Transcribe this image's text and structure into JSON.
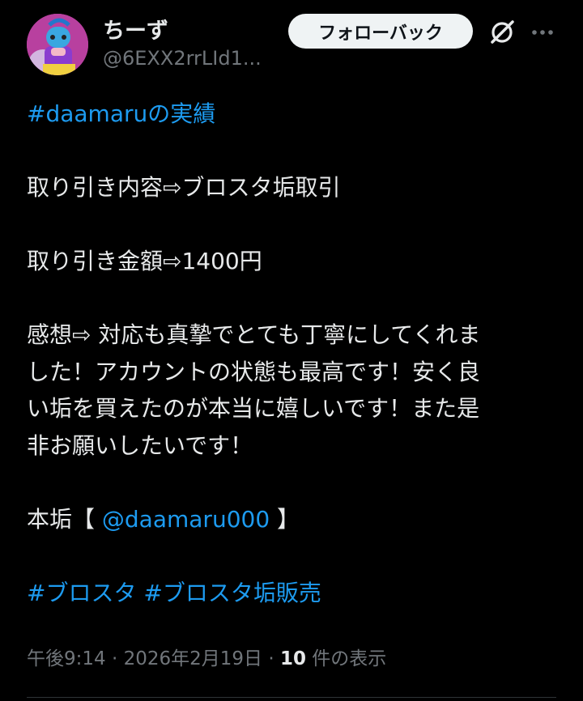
{
  "author": {
    "display_name": "ちーず",
    "handle": "@6EXX2rrLId1..."
  },
  "header": {
    "follow_back_label": "フォローバック",
    "grok_icon": "grok-icon",
    "more_icon": "more-icon"
  },
  "tweet": {
    "hashtag_title": "#daamaruの実績",
    "line_deal": "取り引き内容⇨ブロスタ垢取引",
    "line_amount": "取り引き金額⇨1400円",
    "impression_1": "感想⇨ 対応も真摯でとても丁寧にしてくれま",
    "impression_2": "した！アカウントの状態も最高です！安く良",
    "impression_3": "い垢を買えたのが本当に嬉しいです！また是",
    "impression_4": "非お願いしたいです！",
    "main_prefix": "本垢【 ",
    "mention": "@daamaru000",
    "main_suffix": " 】",
    "tag_1": "#ブロスタ",
    "tag_2": "#ブロスタ垢販売"
  },
  "meta": {
    "time": "午後9:14",
    "sep": " · ",
    "date": "2026年2月19日",
    "views_count": "10",
    "views_label": " 件の表示"
  },
  "colors": {
    "background": "#000000",
    "text": "#e7e9ea",
    "secondary": "#71767b",
    "link": "#1d9bf0",
    "button_bg": "#eff3f4"
  }
}
